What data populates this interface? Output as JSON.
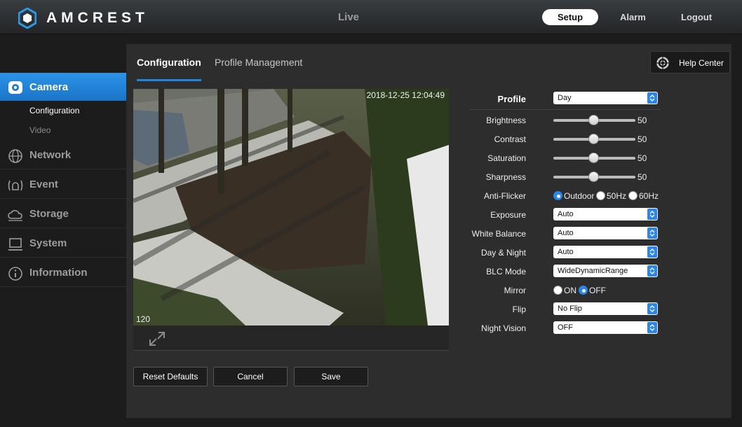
{
  "header": {
    "brand": "AMCREST",
    "nav": {
      "live": "Live",
      "setup": "Setup",
      "alarm": "Alarm",
      "logout": "Logout"
    }
  },
  "sidebar": {
    "items": [
      {
        "label": "Camera",
        "icon": "camera-icon",
        "active": true
      },
      {
        "label": "Network",
        "icon": "globe-icon"
      },
      {
        "label": "Event",
        "icon": "event-icon"
      },
      {
        "label": "Storage",
        "icon": "cloud-icon"
      },
      {
        "label": "System",
        "icon": "monitor-icon"
      },
      {
        "label": "Information",
        "icon": "info-icon"
      }
    ],
    "camera_sub": [
      "Configuration",
      "Video"
    ]
  },
  "tabs": {
    "configuration": "Configuration",
    "profile_management": "Profile Management"
  },
  "help": {
    "label": "Help Center"
  },
  "video": {
    "timestamp": "2018-12-25 12:04:49",
    "channel": "120"
  },
  "buttons": {
    "reset": "Reset Defaults",
    "cancel": "Cancel",
    "save": "Save"
  },
  "settings": {
    "profile": {
      "label": "Profile",
      "value": "Day"
    },
    "brightness": {
      "label": "Brightness",
      "value": "50"
    },
    "contrast": {
      "label": "Contrast",
      "value": "50"
    },
    "saturation": {
      "label": "Saturation",
      "value": "50"
    },
    "sharpness": {
      "label": "Sharpness",
      "value": "50"
    },
    "anti_flicker": {
      "label": "Anti-Flicker",
      "options": [
        "Outdoor",
        "50Hz",
        "60Hz"
      ],
      "selected": "Outdoor"
    },
    "exposure": {
      "label": "Exposure",
      "value": "Auto"
    },
    "white_balance": {
      "label": "White Balance",
      "value": "Auto"
    },
    "day_night": {
      "label": "Day & Night",
      "value": "Auto"
    },
    "blc_mode": {
      "label": "BLC Mode",
      "value": "WideDynamicRange"
    },
    "mirror": {
      "label": "Mirror",
      "options": [
        "ON",
        "OFF"
      ],
      "selected": "OFF"
    },
    "flip": {
      "label": "Flip",
      "value": "No Flip"
    },
    "night_vision": {
      "label": "Night Vision",
      "value": "OFF"
    }
  },
  "colors": {
    "accent": "#1d86e0",
    "panel": "#2d2d2d",
    "background": "#1c1c1c"
  }
}
